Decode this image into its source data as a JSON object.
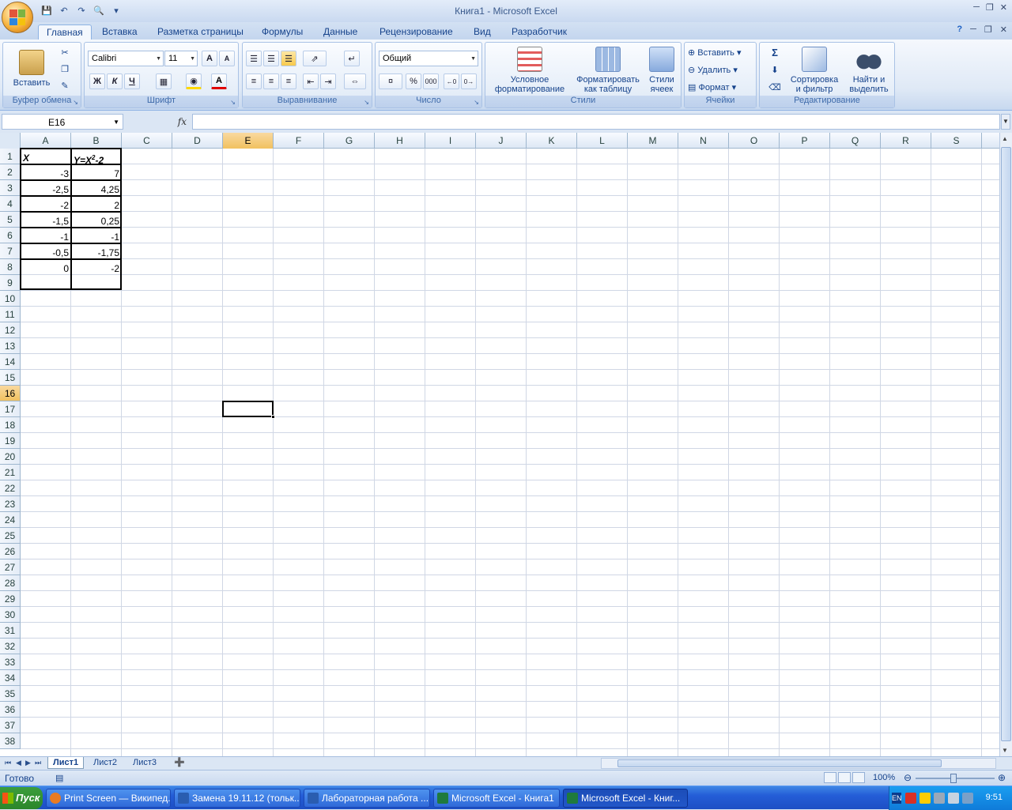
{
  "window": {
    "title": "Книга1  -  Microsoft Excel"
  },
  "tabs": [
    "Главная",
    "Вставка",
    "Разметка страницы",
    "Формулы",
    "Данные",
    "Рецензирование",
    "Вид",
    "Разработчик"
  ],
  "ribbon": {
    "clipboard": {
      "label": "Буфер обмена",
      "paste": "Вставить"
    },
    "font": {
      "label": "Шрифт",
      "font_name": "Calibri",
      "font_size": "11",
      "bold": "Ж",
      "italic": "К",
      "underline": "Ч"
    },
    "alignment": {
      "label": "Выравнивание"
    },
    "number": {
      "label": "Число",
      "format": "Общий",
      "percent": "%",
      "thousands": "000"
    },
    "styles": {
      "label": "Стили",
      "cond_format_1": "Условное",
      "cond_format_2": "форматирование",
      "format_table_1": "Форматировать",
      "format_table_2": "как таблицу",
      "cell_styles_1": "Стили",
      "cell_styles_2": "ячеек"
    },
    "cells": {
      "label": "Ячейки",
      "insert": "Вставить",
      "delete": "Удалить",
      "format": "Формат"
    },
    "editing": {
      "label": "Редактирование",
      "sort_1": "Сортировка",
      "sort_2": "и фильтр",
      "find_1": "Найти и",
      "find_2": "выделить"
    }
  },
  "formula_bar": {
    "name_box": "E16",
    "fx": "fx",
    "value": ""
  },
  "columns": [
    "A",
    "B",
    "C",
    "D",
    "E",
    "F",
    "G",
    "H",
    "I",
    "J",
    "K",
    "L",
    "M",
    "N",
    "O",
    "P",
    "Q",
    "R",
    "S"
  ],
  "selected_column": "E",
  "selected_row": 16,
  "rows_visible": 38,
  "cells": {
    "header_x": "X",
    "header_y": "Y=X",
    "header_y_sup": "2",
    "header_y_tail": "-2",
    "x_values": [
      "-3",
      "-2,5",
      "-2",
      "-1,5",
      "-1",
      "-0,5",
      "0"
    ],
    "y_values": [
      "7",
      "4,25",
      "2",
      "0,25",
      "-1",
      "-1,75",
      "-2"
    ]
  },
  "sheets": [
    "Лист1",
    "Лист2",
    "Лист3"
  ],
  "active_sheet": "Лист1",
  "status": {
    "ready": "Готово",
    "zoom": "100%"
  },
  "taskbar": {
    "start": "Пуск",
    "items": [
      "Print Screen — Википед...",
      "Замена 19.11.12 (тольк...",
      "Лабораторная работа ...",
      "Microsoft Excel - Книга1",
      "Microsoft Excel - Книг..."
    ],
    "lang": "EN",
    "clock": "9:51"
  }
}
